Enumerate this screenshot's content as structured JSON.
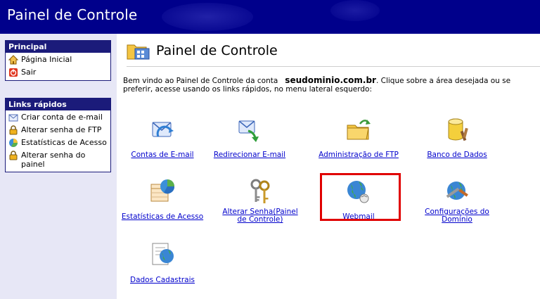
{
  "header": {
    "title": "Painel de Controle"
  },
  "sidebar": {
    "principal": {
      "heading": "Principal",
      "items": [
        {
          "label": "Página Inicial",
          "icon": "home-icon"
        },
        {
          "label": "Sair",
          "icon": "exit-icon"
        }
      ]
    },
    "links": {
      "heading": "Links rápidos",
      "items": [
        {
          "label": "Criar conta de e-mail",
          "icon": "envelope-icon"
        },
        {
          "label": "Alterar senha de FTP",
          "icon": "lock-icon"
        },
        {
          "label": "Estatísticas de Acesso",
          "icon": "stats-icon"
        },
        {
          "label": "Alterar senha do painel",
          "icon": "lock-icon"
        }
      ]
    }
  },
  "main": {
    "title": "Painel de Controle",
    "welcome_prefix": "Bem vindo ao Painel de Controle da conta",
    "domain": "seudominio.com.br",
    "welcome_suffix": ". Clique sobre a área desejada ou se preferir, acesse usando os links rápidos, no menu lateral esquerdo:",
    "tiles": [
      {
        "label": "Contas de E-mail",
        "icon": "email-accounts-icon"
      },
      {
        "label": "Redirecionar E-mail",
        "icon": "email-redirect-icon"
      },
      {
        "label": "Administração de FTP",
        "icon": "ftp-folder-icon"
      },
      {
        "label": "Banco de Dados",
        "icon": "database-icon"
      },
      {
        "label": "Estatísticas de Acesso",
        "icon": "statistics-icon"
      },
      {
        "label": "Alterar Senha(Painel de Controle)",
        "icon": "keys-icon"
      },
      {
        "label": "Webmail",
        "icon": "webmail-globe-icon"
      },
      {
        "label": "Configurações do Domínio",
        "icon": "domain-settings-icon"
      },
      {
        "label": "Dados Cadastrais",
        "icon": "registration-data-icon"
      }
    ],
    "highlight_color": "#e00000"
  },
  "colors": {
    "header_bg": "#00008b",
    "sidebar_bg": "#e7e7f6",
    "box_header": "#1b1b7a",
    "link": "#0000cc"
  }
}
